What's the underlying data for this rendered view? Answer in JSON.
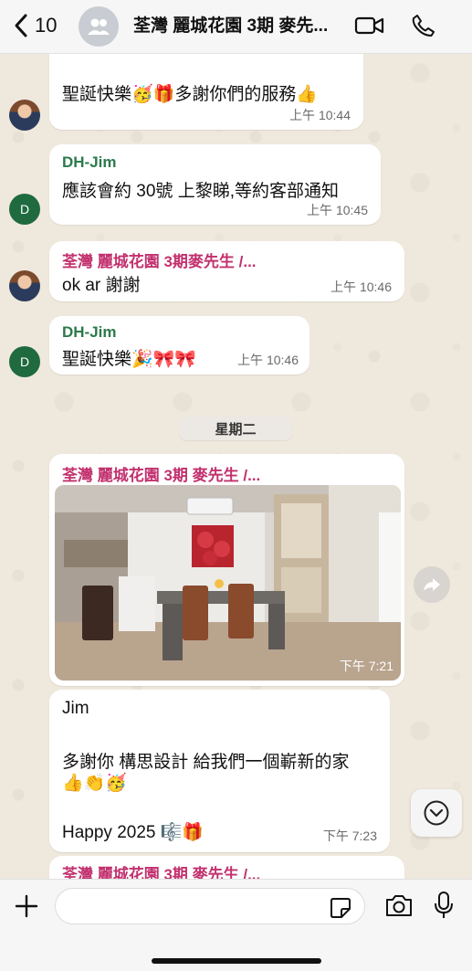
{
  "header": {
    "back_count": "10",
    "title": "荃灣 麗城花園 3期 麥先...",
    "icons": [
      "chevron-left-icon",
      "group-avatar-icon",
      "video-call-icon",
      "phone-icon"
    ]
  },
  "messages": [
    {
      "sender": "",
      "text": "聖誕快樂🥳🎁多謝你們的服務👍",
      "time": "上午 10:44"
    },
    {
      "sender": "DH-Jim",
      "text": "應該會約 30號 上黎睇,等約客部通知",
      "time": "上午 10:45"
    },
    {
      "sender": "荃灣 麗城花園 3期麥先生 /...",
      "text": "ok ar 謝謝",
      "time": "上午 10:46"
    },
    {
      "sender": "DH-Jim",
      "text": "聖誕快樂🎉🎀🎀",
      "time": "上午 10:46"
    }
  ],
  "avatar_letter": "D",
  "date_divider": "星期二",
  "photo_message": {
    "sender": "荃灣 麗城花園 3期 麥先生 /...",
    "time": "下午 7:21"
  },
  "text_message": {
    "line1": "Jim",
    "line2": "多謝你 構思設計 給我們一個嶄新的家",
    "line3": "👍👏🥳",
    "line4": "Happy 2025 🎼🎁",
    "time": "下午 7:23"
  },
  "last_sender": "荃灣 麗城花園 3期 麥先生 /...",
  "input": {
    "placeholder": "",
    "value": ""
  },
  "colors": {
    "accent_pink": "#c2316e",
    "accent_green": "#2b7a4b",
    "bubble": "#ffffff"
  }
}
